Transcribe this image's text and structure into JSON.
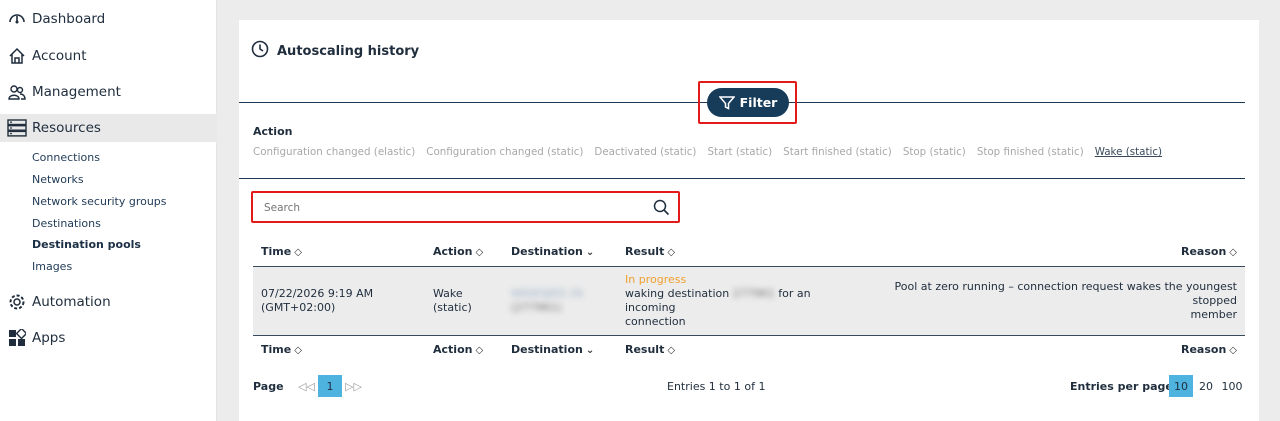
{
  "sidebar": {
    "items": [
      {
        "label": "Dashboard",
        "icon": "gauge-icon"
      },
      {
        "label": "Account",
        "icon": "home-icon"
      },
      {
        "label": "Management",
        "icon": "users-icon"
      },
      {
        "label": "Resources",
        "icon": "server-icon"
      },
      {
        "label": "Automation",
        "icon": "gear-icon"
      },
      {
        "label": "Apps",
        "icon": "apps-icon"
      }
    ],
    "subitems": [
      "Connections",
      "Networks",
      "Network security groups",
      "Destinations",
      "Destination pools",
      "Images"
    ]
  },
  "card": {
    "title": "Autoscaling history",
    "filter_label": "Filter",
    "action_heading": "Action",
    "action_chips": [
      "Configuration changed (elastic)",
      "Configuration changed (static)",
      "Deactivated (static)",
      "Start (static)",
      "Start finished (static)",
      "Stop (static)",
      "Stop finished (static)",
      "Wake (static)"
    ],
    "search_placeholder": "Search"
  },
  "table": {
    "headers": [
      "Time",
      "Action",
      "Destination",
      "Result",
      "Reason"
    ],
    "row": {
      "time": "07/22/2026 9:19 AM",
      "timezone": "(GMT+02:00)",
      "action_1": "Wake",
      "action_2": "(static)",
      "destination_1": "WKWSJRD 26",
      "destination_2": "(277961)",
      "status": "In progress",
      "result_pre": "waking destination",
      "result_blur": "277961",
      "result_post": "for an incoming",
      "result_line2": "connection",
      "reason_1": "Pool at zero running – connection request wakes the youngest stopped",
      "reason_2": "member"
    }
  },
  "pager": {
    "page_label": "Page",
    "first": "◁◁",
    "last": "▷▷",
    "current_page": "1",
    "entries_text": "Entries 1 to 1 of 1",
    "epp_label": "Entries per page",
    "epp_options": [
      "10",
      "20",
      "100"
    ]
  },
  "colors": {
    "accent": "#173c5a",
    "highlight": "#e21a1a",
    "status": "#f0a030",
    "selected": "#4fb3df"
  }
}
